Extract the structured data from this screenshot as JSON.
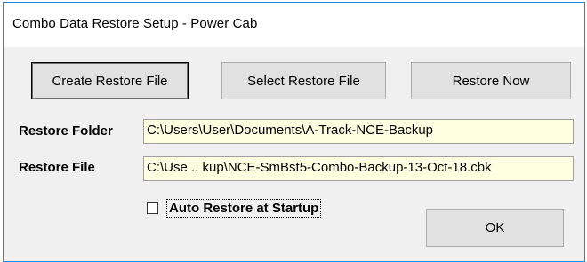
{
  "window": {
    "title": "Combo Data Restore Setup - Power Cab"
  },
  "buttons": {
    "create": "Create Restore File",
    "select": "Select Restore File",
    "restore": "Restore Now",
    "ok": "OK"
  },
  "fields": {
    "folder_label": "Restore Folder",
    "folder_value": "C:\\Users\\User\\Documents\\A-Track-NCE-Backup",
    "file_label": "Restore File",
    "file_value": "C:\\Use .. kup\\NCE-SmBst5-Combo-Backup-13-Oct-18.cbk"
  },
  "auto_restore": {
    "label": "Auto Restore at Startup",
    "checked": false
  },
  "colors": {
    "field_bg": "#ffffe1",
    "window_border": "#1e88e5"
  }
}
